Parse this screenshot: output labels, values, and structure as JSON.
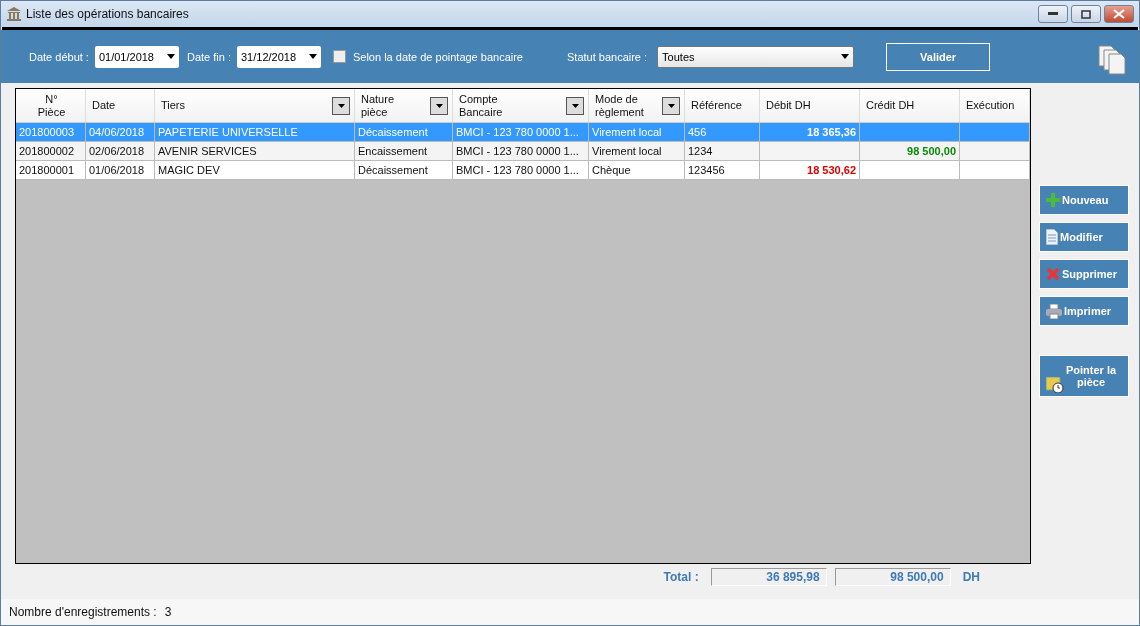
{
  "window": {
    "title": "Liste des opérations bancaires"
  },
  "filters": {
    "date_debut_label": "Date début :",
    "date_debut": "01/01/2018",
    "date_fin_label": "Date fin :",
    "date_fin": "31/12/2018",
    "pointage": {
      "label": "Selon la date de pointage bancaire",
      "checked": false
    },
    "statut_label": "Statut bancaire :",
    "statut": "Toutes",
    "validate": "Valider"
  },
  "table": {
    "columns": [
      {
        "label": "N°\nPièce",
        "filter": false
      },
      {
        "label": "Date",
        "filter": false
      },
      {
        "label": "Tiers",
        "filter": true
      },
      {
        "label": "Nature\npièce",
        "filter": true
      },
      {
        "label": "Compte\nBancaire",
        "filter": true
      },
      {
        "label": "Mode de\nrèglement",
        "filter": true
      },
      {
        "label": "Référence",
        "filter": false
      },
      {
        "label": "Débit DH",
        "filter": false
      },
      {
        "label": "Crédit DH",
        "filter": false
      },
      {
        "label": "Exécution",
        "filter": false
      }
    ],
    "rows": [
      {
        "selected": true,
        "cells": [
          "201800003",
          "04/06/2018",
          "PAPETERIE UNIVERSELLE",
          "Décaissement",
          "BMCI - 123 780 0000 1...",
          "Virement local",
          "456",
          "18 365,36",
          "",
          ""
        ]
      },
      {
        "selected": false,
        "cells": [
          "201800002",
          "02/06/2018",
          "AVENIR SERVICES",
          "Encaissement",
          "BMCI - 123 780 0000 1...",
          "Virement local",
          "1234",
          "",
          "98 500,00",
          ""
        ]
      },
      {
        "selected": false,
        "cells": [
          "201800001",
          "01/06/2018",
          "MAGIC DEV",
          "Décaissement",
          "BMCI - 123 780 0000 1...",
          "Chèque",
          "123456",
          "18 530,62",
          "",
          ""
        ]
      }
    ]
  },
  "actions": [
    {
      "label": "Nouveau",
      "kind": "add"
    },
    {
      "label": "Modifier",
      "kind": "edit"
    },
    {
      "label": "Supprimer",
      "kind": "delete"
    },
    {
      "label": "Imprimer",
      "kind": "print"
    },
    {
      "label": "Pointer la pièce",
      "kind": "point"
    }
  ],
  "totals": {
    "label": "Total :",
    "debit": "36 895,98",
    "credit": "98 500,00",
    "currency": "DH"
  },
  "status_bar": {
    "label": "Nombre d'enregistrements :",
    "count": "3"
  }
}
